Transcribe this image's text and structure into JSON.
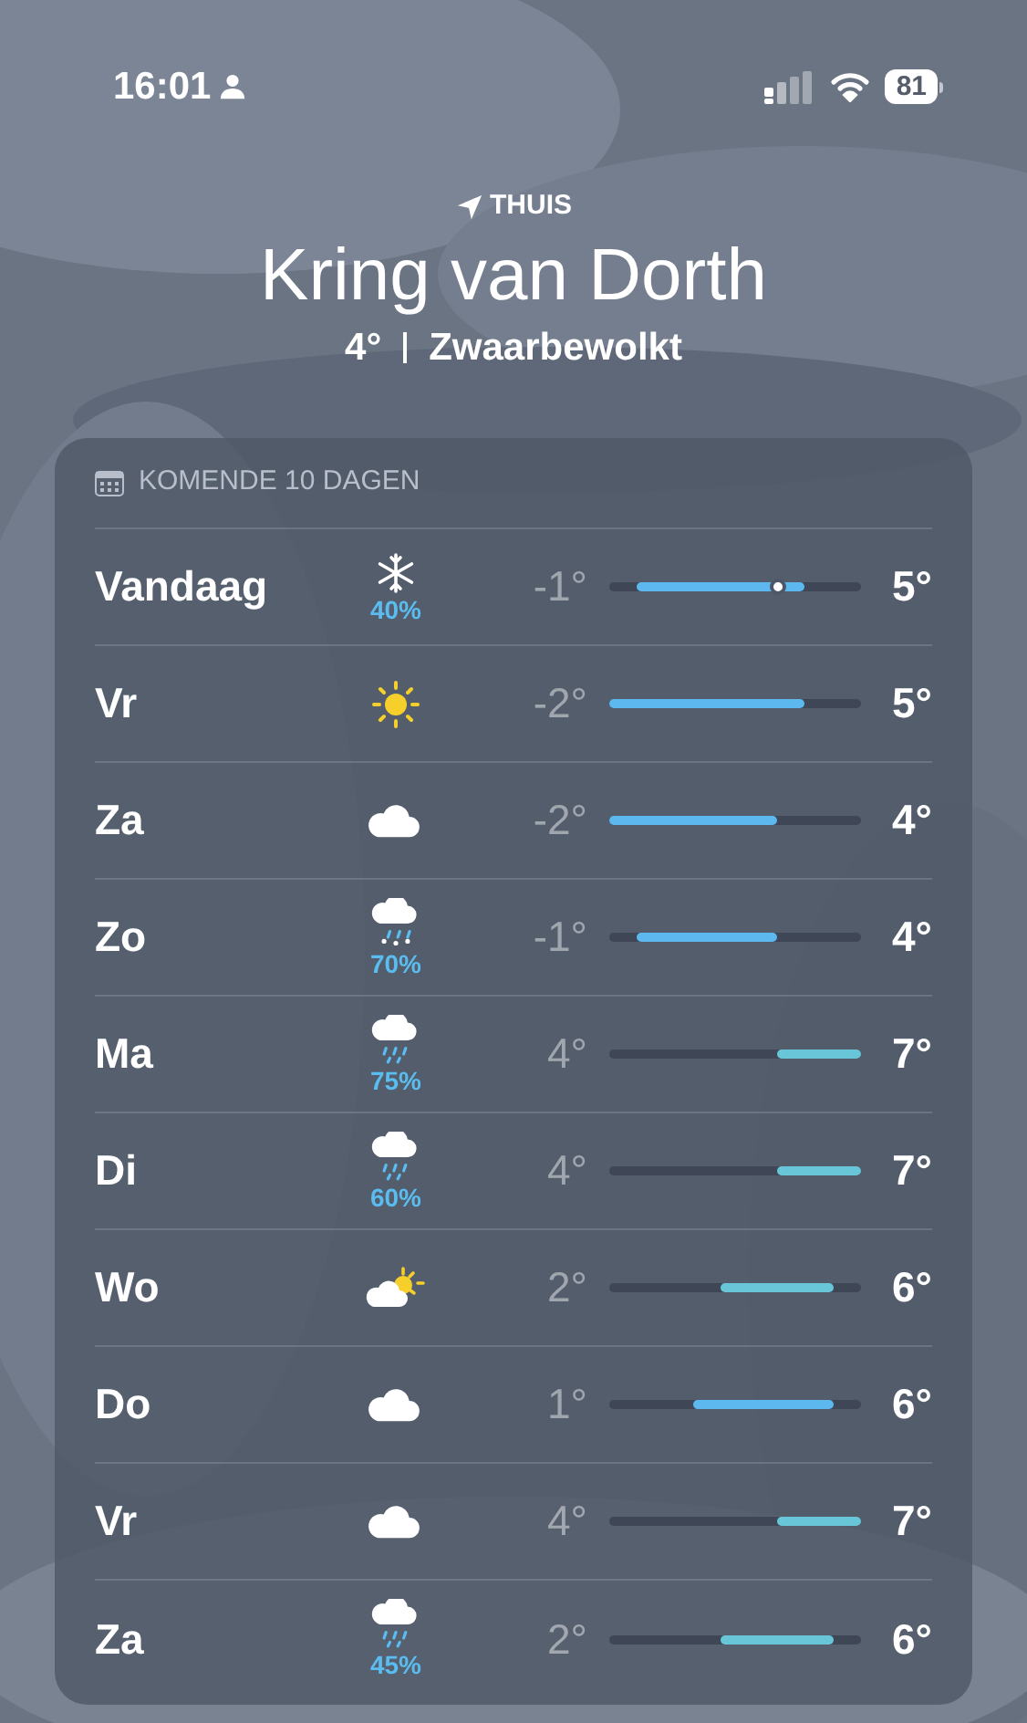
{
  "status_bar": {
    "time": "16:01",
    "battery": "81"
  },
  "location": {
    "label": "THUIS",
    "name": "Kring van Dorth",
    "temperature": "4°",
    "condition": "Zwaarbewolkt"
  },
  "forecast": {
    "title": "KOMENDE 10 DAGEN",
    "days": [
      {
        "day": "Vandaag",
        "kind": "snow",
        "precip": "40%",
        "low": "-1°",
        "high": "5°",
        "current_marker": true
      },
      {
        "day": "Vr",
        "kind": "sun",
        "low": "-2°",
        "high": "5°",
        "current_marker": false
      },
      {
        "day": "Za",
        "kind": "cloud",
        "low": "-2°",
        "high": "4°",
        "current_marker": false
      },
      {
        "day": "Zo",
        "kind": "sleet",
        "precip": "70%",
        "low": "-1°",
        "high": "4°",
        "current_marker": false
      },
      {
        "day": "Ma",
        "kind": "rain",
        "precip": "75%",
        "low": "4°",
        "high": "7°",
        "current_marker": false
      },
      {
        "day": "Di",
        "kind": "rain",
        "precip": "60%",
        "low": "4°",
        "high": "7°",
        "current_marker": false
      },
      {
        "day": "Wo",
        "kind": "partly_sunny",
        "low": "2°",
        "high": "6°",
        "current_marker": false
      },
      {
        "day": "Do",
        "kind": "cloud",
        "low": "1°",
        "high": "6°",
        "current_marker": false
      },
      {
        "day": "Vr",
        "kind": "cloud",
        "low": "4°",
        "high": "7°",
        "current_marker": false
      },
      {
        "day": "Za",
        "kind": "rain",
        "precip": "45%",
        "low": "2°",
        "high": "6°",
        "current_marker": false
      }
    ]
  }
}
